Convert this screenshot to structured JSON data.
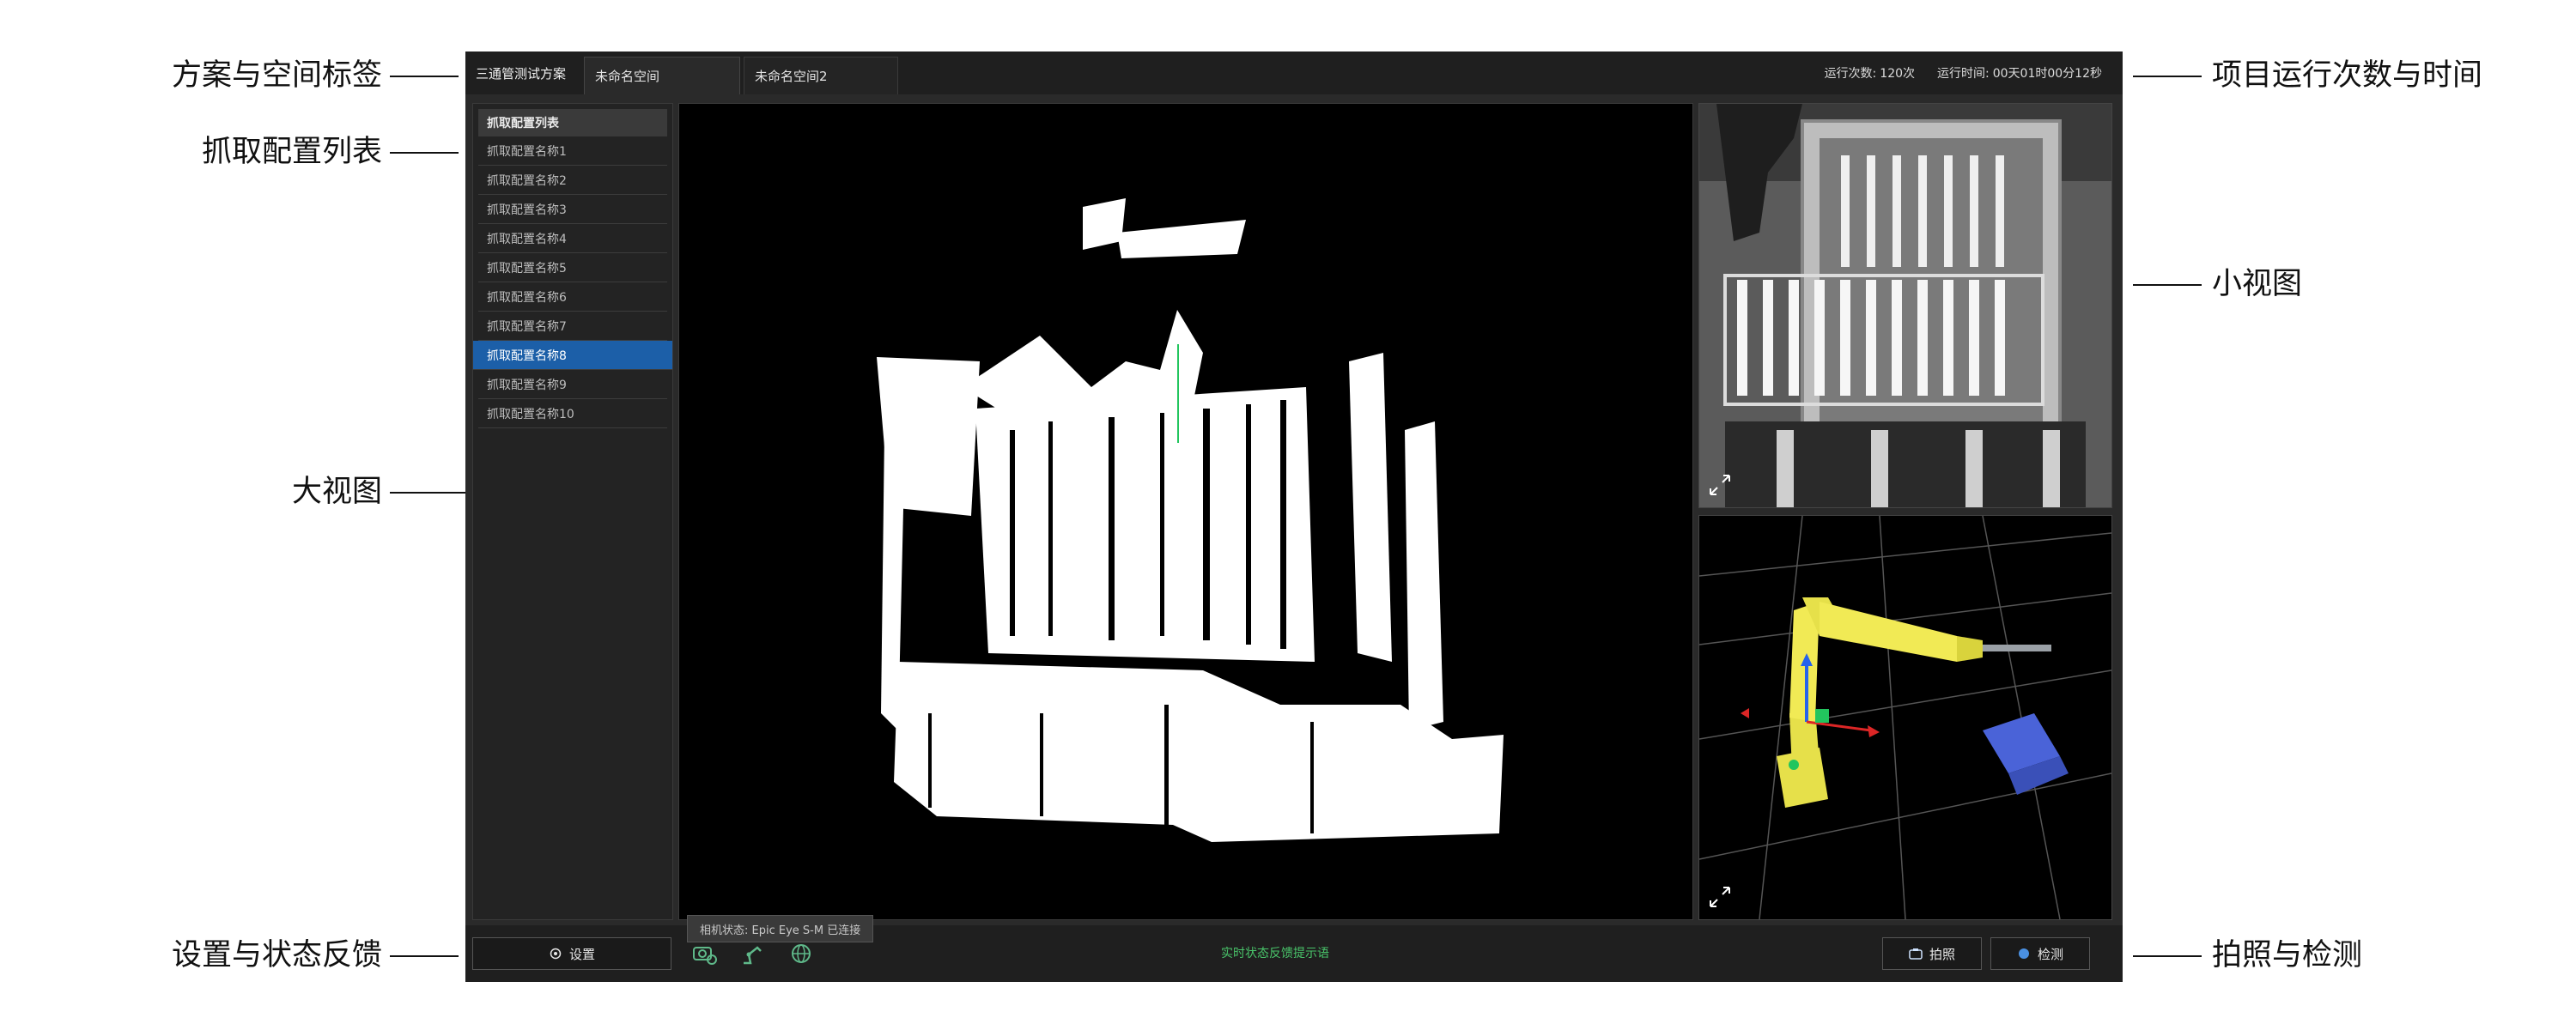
{
  "callouts": {
    "tabs": "方案与空间标签",
    "grab_list": "抓取配置列表",
    "main_view": "大视图",
    "settings_status": "设置与状态反馈",
    "run_stats": "项目运行次数与时间",
    "small_view": "小视图",
    "capture_detect": "拍照与检测"
  },
  "header": {
    "scheme_name": "三通管测试方案",
    "tabs": [
      {
        "label": "未命名空间",
        "active": true
      },
      {
        "label": "未命名空间2",
        "active": false
      }
    ],
    "run_count_label": "运行次数:",
    "run_count_value": "120次",
    "run_time_label": "运行时间:",
    "run_time_value": "00天01时00分12秒"
  },
  "sidebar": {
    "header": "抓取配置列表",
    "items": [
      {
        "label": "抓取配置名称1",
        "selected": false
      },
      {
        "label": "抓取配置名称2",
        "selected": false
      },
      {
        "label": "抓取配置名称3",
        "selected": false
      },
      {
        "label": "抓取配置名称4",
        "selected": false
      },
      {
        "label": "抓取配置名称5",
        "selected": false
      },
      {
        "label": "抓取配置名称6",
        "selected": false
      },
      {
        "label": "抓取配置名称7",
        "selected": false
      },
      {
        "label": "抓取配置名称8",
        "selected": true
      },
      {
        "label": "抓取配置名称9",
        "selected": false
      },
      {
        "label": "抓取配置名称10",
        "selected": false
      }
    ]
  },
  "footer": {
    "settings_label": "设置",
    "camera_status": "相机状态: Epic Eye S-M 已连接",
    "feedback_text": "实时状态反馈提示语",
    "capture_label": "拍照",
    "detect_label": "检测"
  },
  "colors": {
    "selected_item": "#1c5fa8",
    "feedback_text": "#49c46a",
    "robot_yellow": "#e6e04a",
    "workpiece_blue": "#4a63d8"
  },
  "icons": [
    "expand-icon",
    "camera-settings-icon",
    "robot-arm-icon",
    "globe-icon",
    "gear-icon",
    "camera-icon",
    "detect-icon"
  ]
}
